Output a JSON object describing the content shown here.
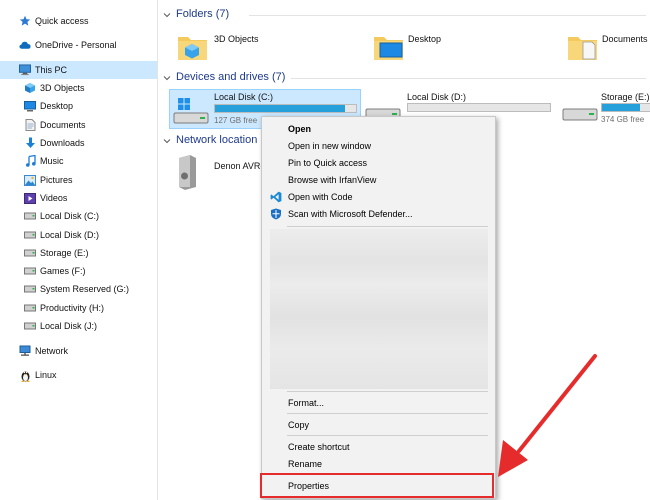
{
  "sidebar": {
    "items": [
      {
        "label": "Quick access",
        "icon": "star-icon"
      },
      {
        "label": "OneDrive - Personal",
        "icon": "cloud-icon"
      },
      {
        "label": "This PC",
        "icon": "computer-icon"
      },
      {
        "label": "3D Objects",
        "icon": "cube-icon"
      },
      {
        "label": "Desktop",
        "icon": "desktop-icon"
      },
      {
        "label": "Documents",
        "icon": "document-icon"
      },
      {
        "label": "Downloads",
        "icon": "download-icon"
      },
      {
        "label": "Music",
        "icon": "music-icon"
      },
      {
        "label": "Pictures",
        "icon": "pictures-icon"
      },
      {
        "label": "Videos",
        "icon": "video-icon"
      },
      {
        "label": "Local Disk (C:)",
        "icon": "drive-icon"
      },
      {
        "label": "Local Disk (D:)",
        "icon": "drive-icon"
      },
      {
        "label": "Storage (E:)",
        "icon": "drive-icon"
      },
      {
        "label": "Games (F:)",
        "icon": "drive-icon"
      },
      {
        "label": "System Reserved (G:)",
        "icon": "drive-icon"
      },
      {
        "label": "Productivity (H:)",
        "icon": "drive-icon"
      },
      {
        "label": "Local Disk (J:)",
        "icon": "drive-icon"
      },
      {
        "label": "Network",
        "icon": "network-icon"
      },
      {
        "label": "Linux",
        "icon": "linux-icon"
      }
    ]
  },
  "main": {
    "folders_title": "Folders (7)",
    "folders": [
      "3D Objects",
      "Desktop",
      "Documents"
    ],
    "drives_title": "Devices and drives (7)",
    "drives": [
      {
        "name": "Local Disk (C:)",
        "free": "127 GB free",
        "used_fraction": 0.92
      },
      {
        "name": "Local Disk (D:)",
        "free": "",
        "used_fraction": 0.0
      },
      {
        "name": "Storage (E:)",
        "free": "374 GB free",
        "used_fraction": 0.75
      }
    ],
    "network_title": "Network location",
    "network_items": [
      "Denon AVR-"
    ]
  },
  "context_menu": {
    "items": [
      {
        "label": "Open",
        "bold": true
      },
      {
        "label": "Open in new window"
      },
      {
        "label": "Pin to Quick access"
      },
      {
        "label": "Browse with IrfanView"
      },
      {
        "label": "Open with Code",
        "icon": "vscode-icon"
      },
      {
        "label": "Scan with Microsoft Defender...",
        "icon": "defender-icon"
      },
      {
        "label": "Format..."
      },
      {
        "label": "Copy"
      },
      {
        "label": "Create shortcut"
      },
      {
        "label": "Rename"
      },
      {
        "label": "Properties"
      }
    ]
  },
  "colors": {
    "accent": "#26a0da",
    "selected": "#cce8ff",
    "section_title": "#1e3a8a",
    "highlight": "#e52b2b"
  }
}
